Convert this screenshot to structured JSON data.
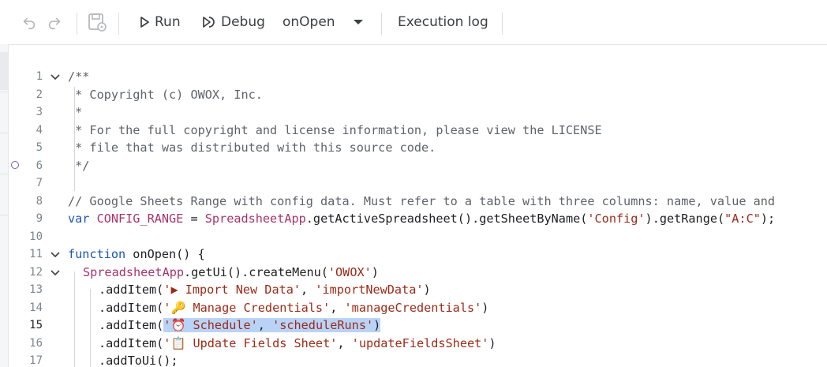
{
  "toolbar": {
    "undo_icon": "undo-icon",
    "redo_icon": "redo-icon",
    "save_icon": "save-drive-icon",
    "run_label": "Run",
    "debug_label": "Debug",
    "function_select": "onOpen",
    "execution_log_label": "Execution log"
  },
  "colors": {
    "comment": "#5f6368",
    "keyword": "#1a56b4",
    "variable": "#a8336a",
    "string": "#9c2a17",
    "selection": "#b9d3f7",
    "breakpoint": "#7b5ac7"
  },
  "editor": {
    "line_numbers": [
      "1",
      "2",
      "3",
      "4",
      "5",
      "6",
      "7",
      "8",
      "9",
      "10",
      "11",
      "12",
      "13",
      "14",
      "15",
      "16",
      "17"
    ],
    "lines": {
      "l1": "/**",
      "l2": " * Copyright (c) OWOX, Inc.",
      "l3": " *",
      "l4": " * For the full copyright and license information, please view the LICENSE",
      "l5": " * file that was distributed with this source code.",
      "l6": " */",
      "l8": "// Google Sheets Range with config data. Must refer to a table with three columns: name, value and",
      "l9_kw": "var",
      "l9_var": "CONFIG_RANGE",
      "l9_eq": " = ",
      "l9_obj": "SpreadsheetApp",
      "l9_call1": ".getActiveSpreadsheet().getSheetByName(",
      "l9_str1": "'Config'",
      "l9_call2": ").getRange(",
      "l9_str2": "\"A:C\"",
      "l9_end": ");",
      "l11_kw": "function",
      "l11_name": " onOpen() {",
      "l12_obj": "SpreadsheetApp",
      "l12_call": ".getUi().createMenu(",
      "l12_str": "'OWOX'",
      "l12_end": ")",
      "l13_call": ".addItem(",
      "l13_str1": "'▶ Import New Data'",
      "l13_sep": ", ",
      "l13_str2": "'importNewData'",
      "l13_end": ")",
      "l14_call": ".addItem(",
      "l14_str1": "'🔑 Manage Credentials'",
      "l14_sep": ", ",
      "l14_str2": "'manageCredentials'",
      "l14_end": ")",
      "l15_call": ".addItem(",
      "l15_str1": "'⏰ Schedule'",
      "l15_sep": ", ",
      "l15_str2": "'scheduleRuns'",
      "l15_end": ")",
      "l16_call": ".addItem(",
      "l16_str1": "'📋 Update Fields Sheet'",
      "l16_sep": ", ",
      "l16_str2": "'updateFieldsSheet'",
      "l16_end": ")",
      "l17": ".addToUi();"
    }
  }
}
